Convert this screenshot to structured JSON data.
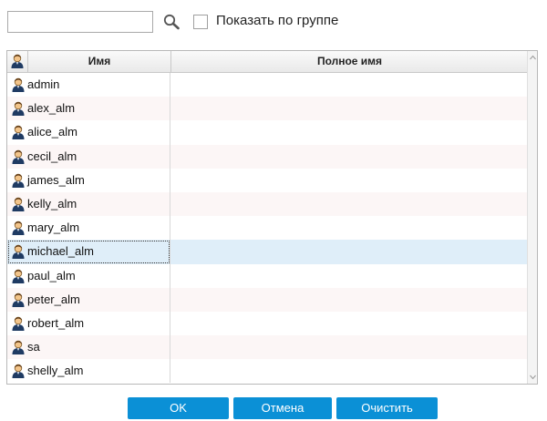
{
  "toolbar": {
    "search_value": "",
    "search_icon": "magnifier-icon",
    "group_checked": false,
    "group_label": "Показать по группе"
  },
  "grid": {
    "columns": {
      "icon": "user-icon",
      "name": "Имя",
      "full_name": "Полное имя"
    },
    "rows": [
      {
        "name": "admin",
        "full_name": ""
      },
      {
        "name": "alex_alm",
        "full_name": ""
      },
      {
        "name": "alice_alm",
        "full_name": ""
      },
      {
        "name": "cecil_alm",
        "full_name": ""
      },
      {
        "name": "james_alm",
        "full_name": ""
      },
      {
        "name": "kelly_alm",
        "full_name": ""
      },
      {
        "name": "mary_alm",
        "full_name": ""
      },
      {
        "name": "michael_alm",
        "full_name": "",
        "selected": true
      },
      {
        "name": "paul_alm",
        "full_name": ""
      },
      {
        "name": "peter_alm",
        "full_name": ""
      },
      {
        "name": "robert_alm",
        "full_name": ""
      },
      {
        "name": "sa",
        "full_name": ""
      },
      {
        "name": "shelly_alm",
        "full_name": ""
      }
    ]
  },
  "buttons": {
    "ok": "OK",
    "cancel": "Отмена",
    "clear": "Очистить"
  },
  "colors": {
    "button_bg": "#0b90d6",
    "selected_row": "#dfeef9",
    "alt_row": "#fcf6f6"
  }
}
